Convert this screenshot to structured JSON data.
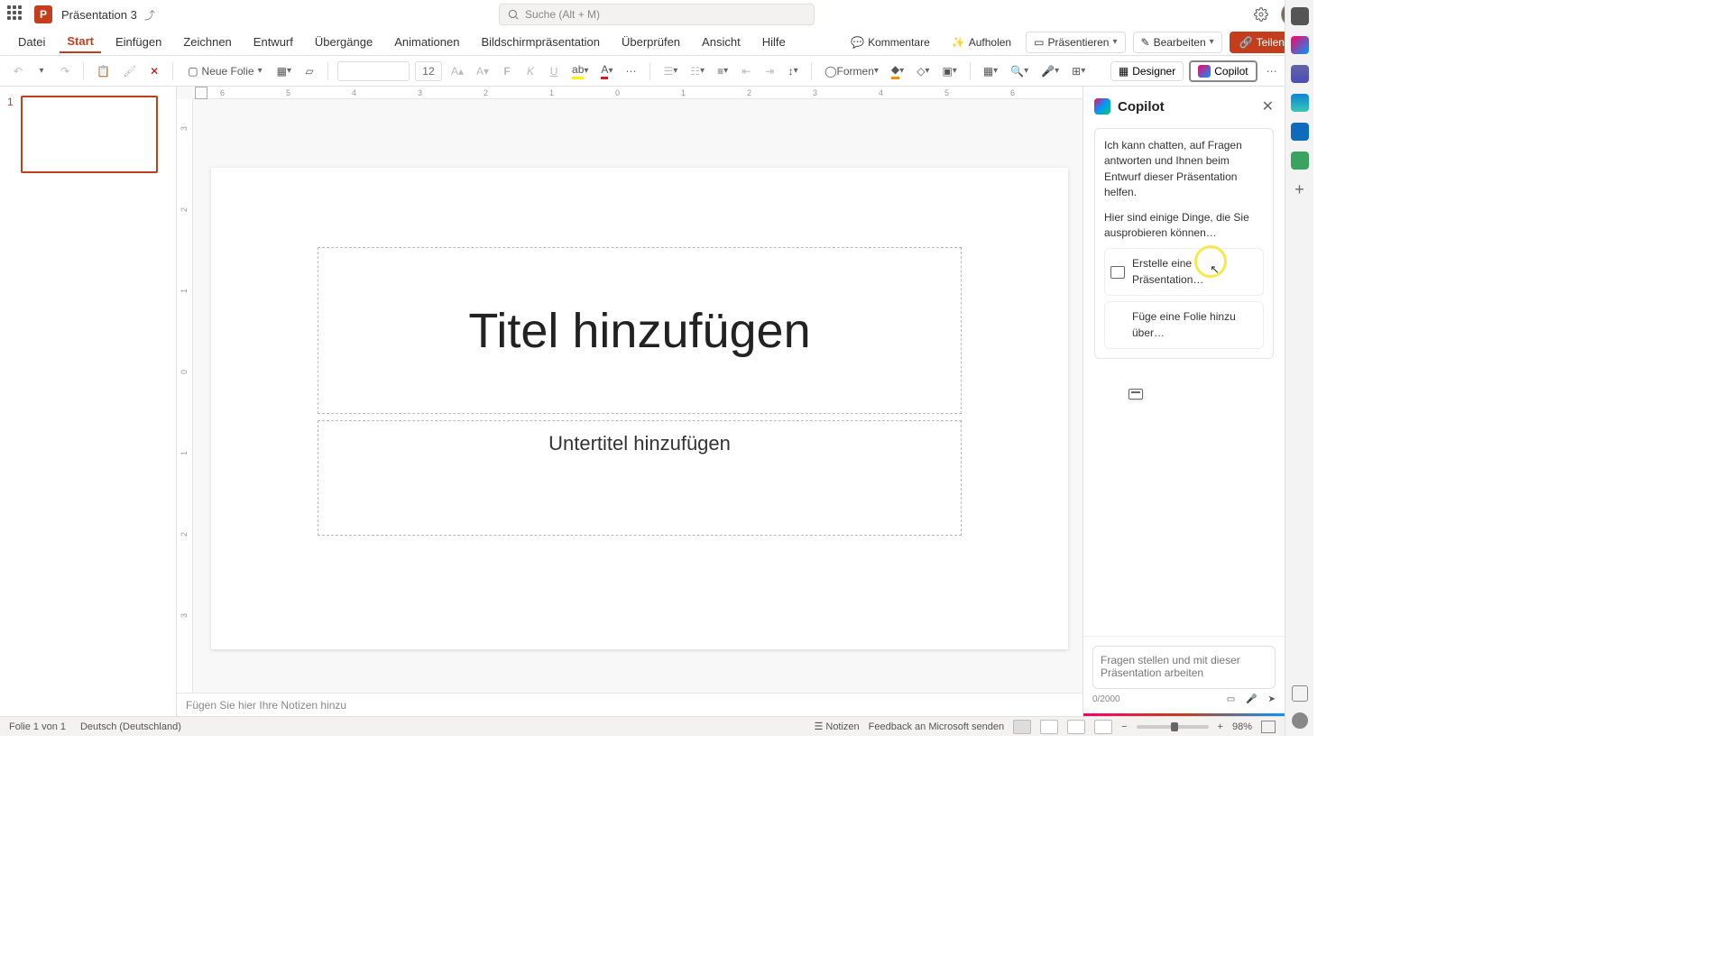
{
  "titlebar": {
    "doc_name": "Präsentation 3",
    "search_placeholder": "Suche (Alt + M)"
  },
  "tabs": {
    "datei": "Datei",
    "start": "Start",
    "einfuegen": "Einfügen",
    "zeichnen": "Zeichnen",
    "entwurf": "Entwurf",
    "uebergaenge": "Übergänge",
    "animationen": "Animationen",
    "bildschirm": "Bildschirmpräsentation",
    "ueberpruefen": "Überprüfen",
    "ansicht": "Ansicht",
    "hilfe": "Hilfe"
  },
  "ribbon_right": {
    "kommentare": "Kommentare",
    "aufholen": "Aufholen",
    "praesentieren": "Präsentieren",
    "bearbeiten": "Bearbeiten",
    "teilen": "Teilen"
  },
  "toolbar": {
    "neue_folie": "Neue Folie",
    "font_size": "12",
    "formen": "Formen",
    "designer": "Designer",
    "copilot": "Copilot"
  },
  "thumb": {
    "num": "1"
  },
  "slide": {
    "title_ph": "Titel hinzufügen",
    "subtitle_ph": "Untertitel hinzufügen"
  },
  "notes": {
    "placeholder": "Fügen Sie hier Ihre Notizen hinzu"
  },
  "copilot": {
    "title": "Copilot",
    "intro": "Ich kann chatten, auf Fragen antworten und Ihnen beim Entwurf dieser Präsentation helfen.",
    "sub": "Hier sind einige Dinge, die Sie ausprobieren können…",
    "suggest1": "Erstelle eine Präsentation…",
    "suggest2": "Füge eine Folie hinzu über…",
    "input_placeholder": "Fragen stellen und mit dieser Präsentation arbeiten",
    "counter": "0/2000"
  },
  "status": {
    "slide_count": "Folie 1 von 1",
    "lang": "Deutsch (Deutschland)",
    "notizen": "Notizen",
    "feedback": "Feedback an Microsoft senden",
    "zoom": "98%"
  },
  "ruler_h": [
    "6",
    "5",
    "4",
    "3",
    "2",
    "1",
    "0",
    "1",
    "2",
    "3",
    "4",
    "5",
    "6"
  ],
  "ruler_v": [
    "3",
    "2",
    "1",
    "0",
    "1",
    "2",
    "3"
  ]
}
